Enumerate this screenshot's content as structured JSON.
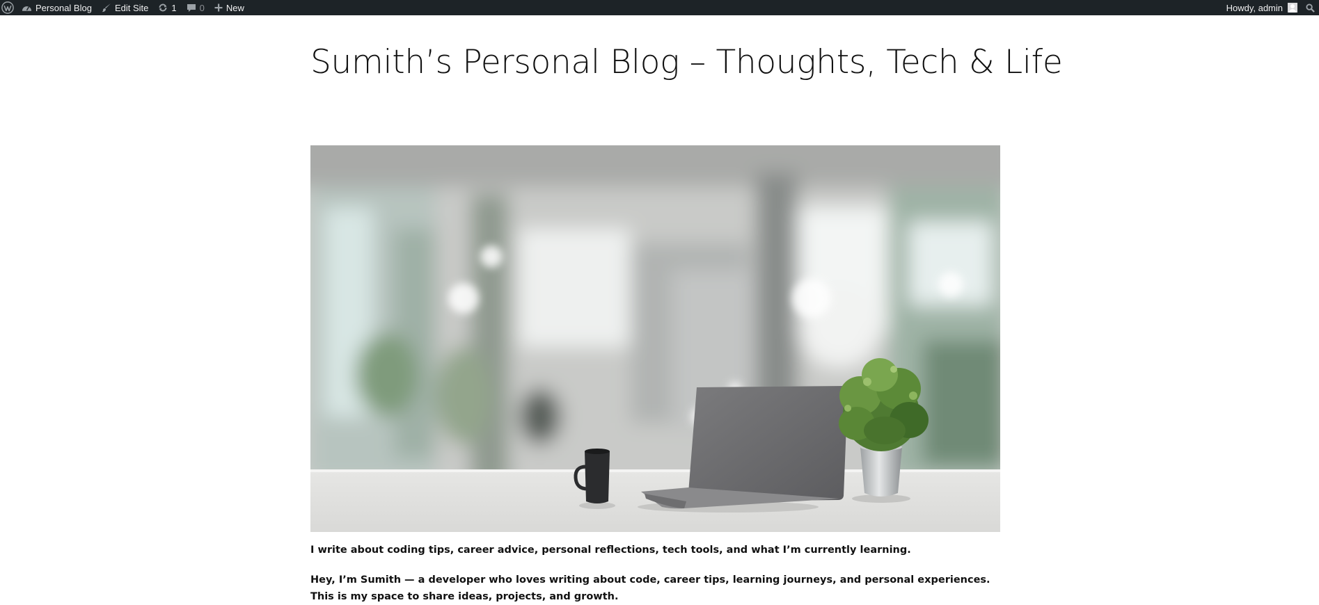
{
  "admin_bar": {
    "site_name": "Personal Blog",
    "edit_site": "Edit Site",
    "updates_count": "1",
    "comments_count": "0",
    "new_label": "New",
    "howdy": "Howdy, admin",
    "background": "#1d2327"
  },
  "site": {
    "title": "Sumith’s Personal Blog – Thoughts, Tech & Life"
  },
  "content": {
    "intro": "I write about coding tips, career advice, personal reflections, tech tools, and what I’m currently learning.",
    "bio_line1": "Hey, I’m Sumith — a developer who loves writing about code, career tips, learning journeys, and personal experiences.",
    "bio_line2": "This is my space to share ideas, projects, and growth."
  },
  "icons": {
    "wp": "wordpress-logo-icon",
    "dashboard": "dashboard-icon",
    "edit": "brush-icon",
    "updates": "updates-icon",
    "comments": "comment-icon",
    "new": "plus-icon",
    "search": "search-icon"
  }
}
